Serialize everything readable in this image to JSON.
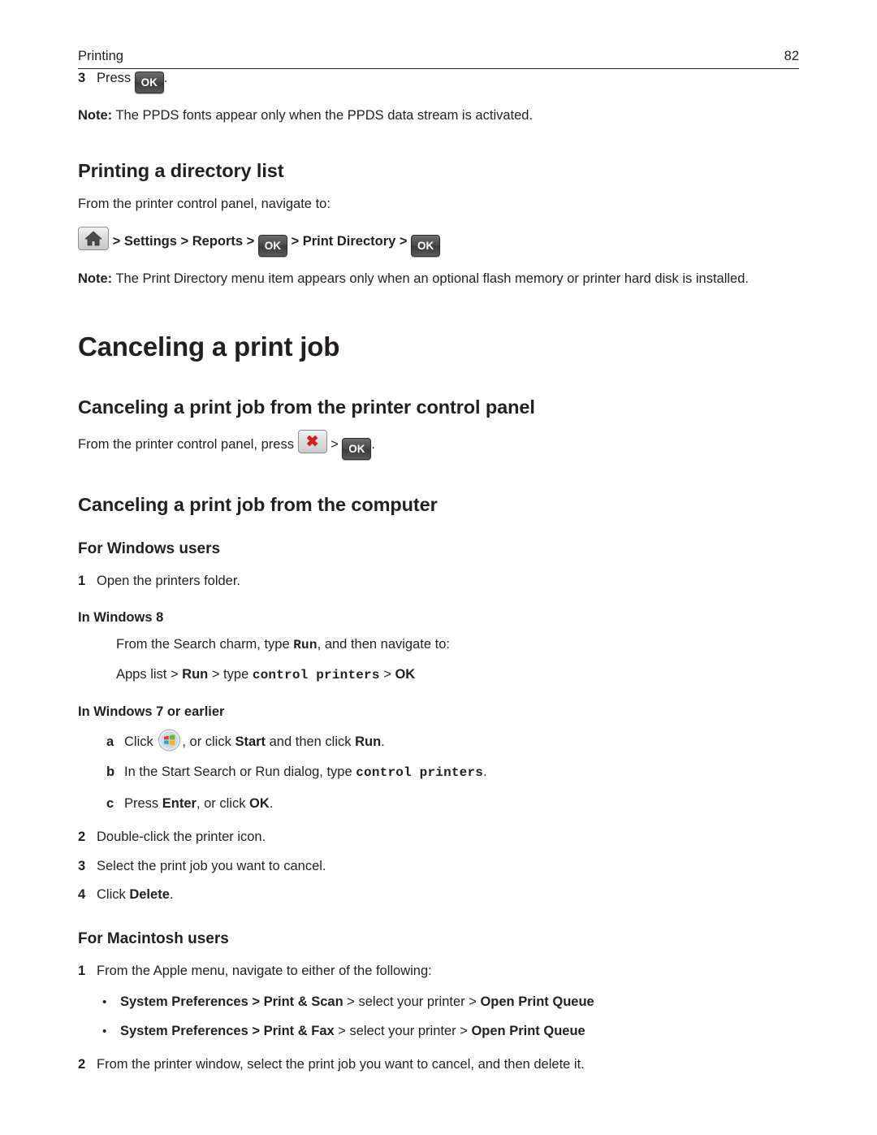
{
  "header": {
    "section": "Printing",
    "page_number": "82"
  },
  "icons": {
    "ok_label": "OK",
    "home_name": "home-icon",
    "cancel_name": "cancel-x-icon",
    "windows_name": "windows-logo-icon"
  },
  "content": {
    "step3_num": "3",
    "step3_text_pre": "Press",
    "step3_text_post": ".",
    "note1_label": "Note:",
    "note1_text": " The PPDS fonts appear only when the PPDS data stream is activated.",
    "h2_directory": "Printing a directory list",
    "directory_intro": "From the printer control panel, navigate to:",
    "nav_sep1": "> ",
    "nav_settings": "Settings",
    "nav_sep2": " > ",
    "nav_reports": "Reports",
    "nav_sep3": " > ",
    "nav_sep4": " > ",
    "nav_print_directory": "Print Directory",
    "nav_sep5": " > ",
    "note2_label": "Note:",
    "note2_text": " The Print Directory menu item appears only when an optional flash memory or printer hard disk is installed.",
    "h1_canceling": "Canceling a print job",
    "h2_cancel_panel": "Canceling a print job from the printer control panel",
    "cancel_panel_text_pre": "From the printer control panel, press",
    "cancel_panel_sep": ">",
    "cancel_panel_text_post": ".",
    "h2_cancel_computer": "Canceling a print job from the computer",
    "h3_windows": "For Windows users",
    "win_step1_num": "1",
    "win_step1_text": "Open the printers folder.",
    "h4_win8": "In Windows 8",
    "win8_line1_pre": "From the Search charm, type ",
    "win8_line1_mono": "Run",
    "win8_line1_post": ", and then navigate to:",
    "win8_line2_a": "Apps list > ",
    "win8_line2_run": "Run",
    "win8_line2_b": " > type ",
    "win8_line2_mono": "control printers",
    "win8_line2_c": " > ",
    "win8_line2_ok": "OK",
    "h4_win7": "In Windows 7 or earlier",
    "a_letter": "a",
    "a_text_pre": "Click",
    "a_text_mid": ", or click ",
    "a_start": "Start",
    "a_text_mid2": " and then click ",
    "a_run": "Run",
    "a_text_post": ".",
    "b_letter": "b",
    "b_text_pre": "In the Start Search or Run dialog, type ",
    "b_mono": "control printers",
    "b_text_post": ".",
    "c_letter": "c",
    "c_text_pre": "Press ",
    "c_enter": "Enter",
    "c_text_mid": ", or click ",
    "c_ok": "OK",
    "c_text_post": ".",
    "win_step2_num": "2",
    "win_step2_text": "Double-click the printer icon.",
    "win_step3_num": "3",
    "win_step3_text": "Select the print job you want to cancel.",
    "win_step4_num": "4",
    "win_step4_text_pre": "Click ",
    "win_step4_delete": "Delete",
    "win_step4_text_post": ".",
    "h3_mac": "For Macintosh users",
    "mac_step1_num": "1",
    "mac_step1_text": "From the Apple menu, navigate to either of the following:",
    "bullet_dot": "•",
    "mac_b1_sysprefs": "System Preferences",
    "mac_b1_sep1": " > ",
    "mac_b1_printscan": "Print & Scan",
    "mac_b1_sep2": " > ",
    "mac_b1_select": "select your printer",
    "mac_b1_sep3": " > ",
    "mac_b1_queue": "Open Print Queue",
    "mac_b2_sysprefs": "System Preferences",
    "mac_b2_sep1": " > ",
    "mac_b2_printfax": "Print & Fax",
    "mac_b2_sep2": " > ",
    "mac_b2_select": "select your printer",
    "mac_b2_sep3": " > ",
    "mac_b2_queue": "Open Print Queue",
    "mac_step2_num": "2",
    "mac_step2_text": "From the printer window, select the print job you want to cancel, and then delete it."
  }
}
